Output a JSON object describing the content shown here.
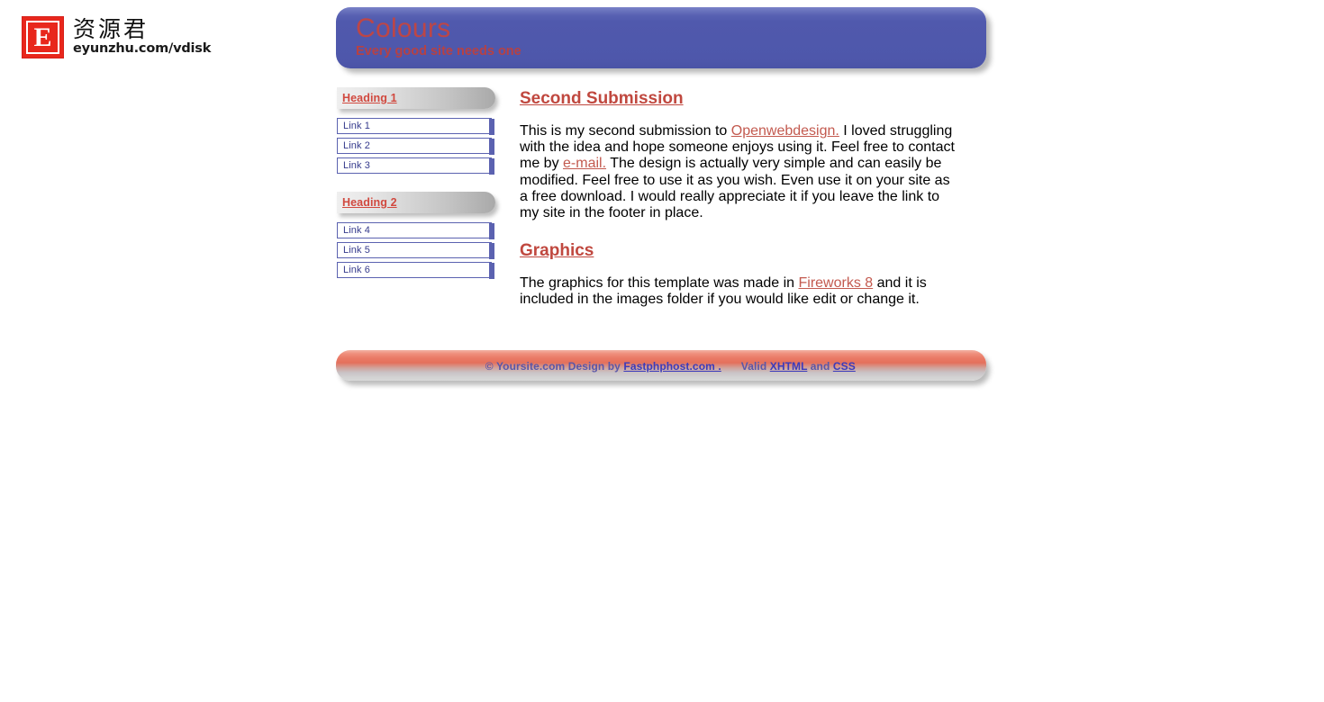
{
  "brand": {
    "mark_letter": "E",
    "chinese_name": "资源君",
    "domain": "eyunzhu.com/vdisk"
  },
  "banner": {
    "title": "Colours",
    "tagline": "Every good site needs one",
    "bg_color": "#5059AD",
    "text_color": "#C6453F"
  },
  "sidebar": {
    "groups": [
      {
        "heading": "Heading 1",
        "links": [
          "Link 1",
          "Link 2",
          "Link 3"
        ]
      },
      {
        "heading": "Heading 2",
        "links": [
          "Link 4",
          "Link 5",
          "Link 6"
        ]
      }
    ],
    "heading_color": "#D1493F",
    "link_color": "#353A8C",
    "accent_color": "#5B62B0"
  },
  "main": {
    "sections": [
      {
        "heading": "Second Submission",
        "paragraph_parts": [
          {
            "type": "text",
            "value": "This is my second submission to "
          },
          {
            "type": "link",
            "value": "Openwebdesign."
          },
          {
            "type": "text",
            "value": " I loved struggling with the idea and hope someone enjoys using it. Feel free to contact me by "
          },
          {
            "type": "link",
            "value": "e-mail."
          },
          {
            "type": "text",
            "value": " The design is actually very simple and can easily be modified. Feel free to use it as you wish. Even use it on your site as a free download. I would really appreciate it if you leave the link to my site in the footer in place."
          }
        ]
      },
      {
        "heading": "Graphics",
        "paragraph_parts": [
          {
            "type": "text",
            "value": "The graphics for this template was made in "
          },
          {
            "type": "link",
            "value": "Fireworks 8"
          },
          {
            "type": "text",
            "value": " and it is included in the images folder if you would like edit or change it."
          }
        ]
      }
    ],
    "heading_color": "#C0483F",
    "link_color": "#C35A4F"
  },
  "footer": {
    "copyright": "© Yoursite.com Design by ",
    "designer_link": "Fastphphost.com .",
    "valid_prefix": "Valid ",
    "xhtml_link": "XHTML",
    "and_text": " and ",
    "css_link": "CSS",
    "text_color": "#5A57A8",
    "link_color": "#3B3BBB"
  }
}
